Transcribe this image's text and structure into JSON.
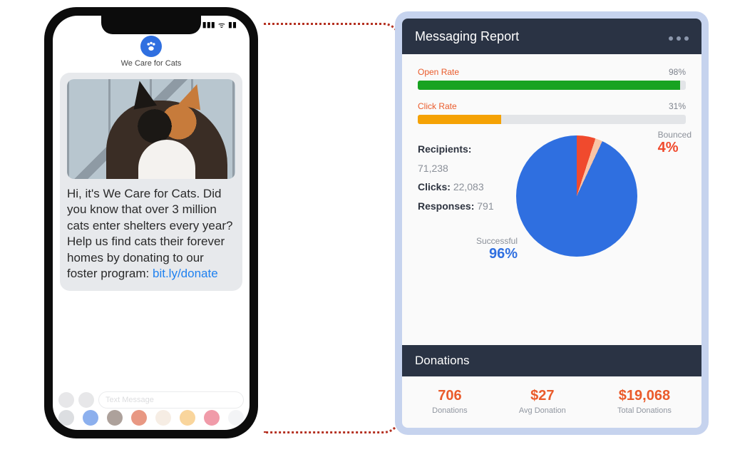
{
  "phone": {
    "brand": "We Care for Cats",
    "message": "Hi, it's We Care for Cats. Did you know that over 3 million cats enter shelters every year? Help us find cats their forever homes by donating to our foster program: ",
    "link_text": "bit.ly/donate",
    "input_placeholder": "Text Message"
  },
  "report": {
    "title": "Messaging Report",
    "open_rate": {
      "label": "Open Rate",
      "value_text": "98%",
      "pct": 98
    },
    "click_rate": {
      "label": "Click Rate",
      "value_text": "31%",
      "pct": 31
    },
    "recipients": {
      "label": "Recipients:",
      "value": "71,238"
    },
    "clicks": {
      "label": "Clicks:",
      "value": "22,083"
    },
    "responses": {
      "label": "Responses:",
      "value": "791"
    },
    "successful": {
      "label": "Successful",
      "value_text": "96%"
    },
    "bounced": {
      "label": "Bounced",
      "value_text": "4%"
    },
    "donations_header": "Donations",
    "donations": {
      "count": {
        "value": "706",
        "label": "Donations"
      },
      "avg": {
        "value": "$27",
        "label": "Avg Donation"
      },
      "total": {
        "value": "$19,068",
        "label": "Total Donations"
      }
    }
  },
  "chart_data": {
    "type": "pie",
    "title": "Delivery outcome",
    "series": [
      {
        "name": "Successful",
        "value": 96,
        "color": "#2f6fe0"
      },
      {
        "name": "Bounced",
        "value": 4,
        "color": "#f04a2d"
      }
    ]
  }
}
